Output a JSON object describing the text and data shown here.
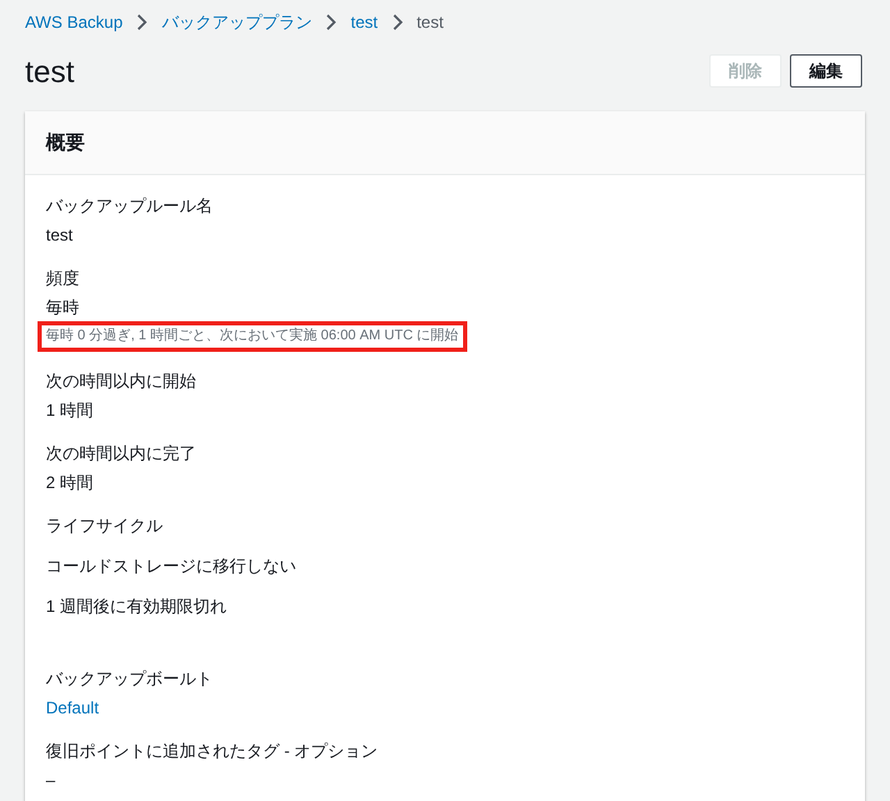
{
  "breadcrumb": [
    {
      "label": "AWS Backup",
      "kind": "link"
    },
    {
      "label": "バックアッププラン",
      "kind": "link"
    },
    {
      "label": "test",
      "kind": "link"
    },
    {
      "label": "test",
      "kind": "current"
    }
  ],
  "page_title": "test",
  "buttons": [
    {
      "label": "削除",
      "disabled": true
    },
    {
      "label": "編集",
      "disabled": false
    }
  ],
  "panel": {
    "title": "概要",
    "sections": [
      {
        "items": [
          {
            "kind": "label",
            "text": "バックアップルール名"
          },
          {
            "kind": "value",
            "text": "test"
          }
        ]
      },
      {
        "items": [
          {
            "kind": "label",
            "text": "頻度"
          },
          {
            "kind": "value",
            "text": "毎時"
          },
          {
            "kind": "note",
            "text": "毎時 0 分過ぎ, 1 時間ごと、次において実施 06:00 AM UTC に開始",
            "highlighted": true
          }
        ]
      },
      {
        "items": [
          {
            "kind": "label",
            "text": "次の時間以内に開始"
          },
          {
            "kind": "value",
            "text": "1 時間"
          }
        ]
      },
      {
        "items": [
          {
            "kind": "label",
            "text": "次の時間以内に完了"
          },
          {
            "kind": "value",
            "text": "2 時間"
          }
        ]
      },
      {
        "items": [
          {
            "kind": "line",
            "text": "ライフサイクル"
          },
          {
            "kind": "line",
            "text": "コールドストレージに移行しない"
          },
          {
            "kind": "line",
            "text": "1 週間後に有効期限切れ"
          }
        ]
      },
      {
        "items": [
          {
            "kind": "label",
            "text": "バックアップボールト"
          },
          {
            "kind": "link",
            "text": "Default"
          }
        ]
      },
      {
        "items": [
          {
            "kind": "label",
            "text": "復旧ポイントに追加されたタグ - オプション"
          },
          {
            "kind": "value",
            "text": "–"
          }
        ]
      }
    ]
  }
}
